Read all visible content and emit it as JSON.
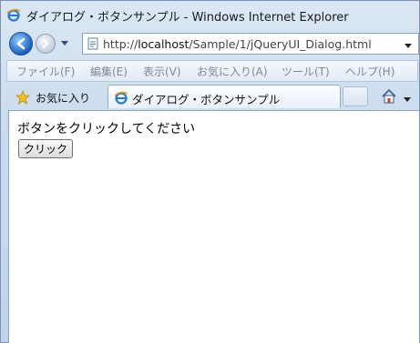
{
  "window": {
    "title": "ダイアログ・ボタンサンプル - Windows Internet Explorer"
  },
  "address": {
    "url_prefix": "http://",
    "url_host": "localhost",
    "url_path": "/Sample/1/jQueryUI_Dialog.html"
  },
  "menu": {
    "items": [
      "ファイル(F)",
      "編集(E)",
      "表示(V)",
      "お気に入り(A)",
      "ツール(T)",
      "ヘルプ(H)"
    ]
  },
  "favorites": {
    "label": "お気に入り"
  },
  "tab": {
    "label": "ダイアログ・ボタンサンプル"
  },
  "page": {
    "prompt": "ボタンをクリックしてください",
    "button_label": "クリック"
  },
  "icons": {
    "ie": "ie-logo-icon",
    "back": "back-arrow-icon",
    "forward": "forward-arrow-icon",
    "star": "favorites-star-icon",
    "home": "home-icon"
  },
  "colors": {
    "chrome": "#c9dbee",
    "accent": "#1d5fbf"
  }
}
